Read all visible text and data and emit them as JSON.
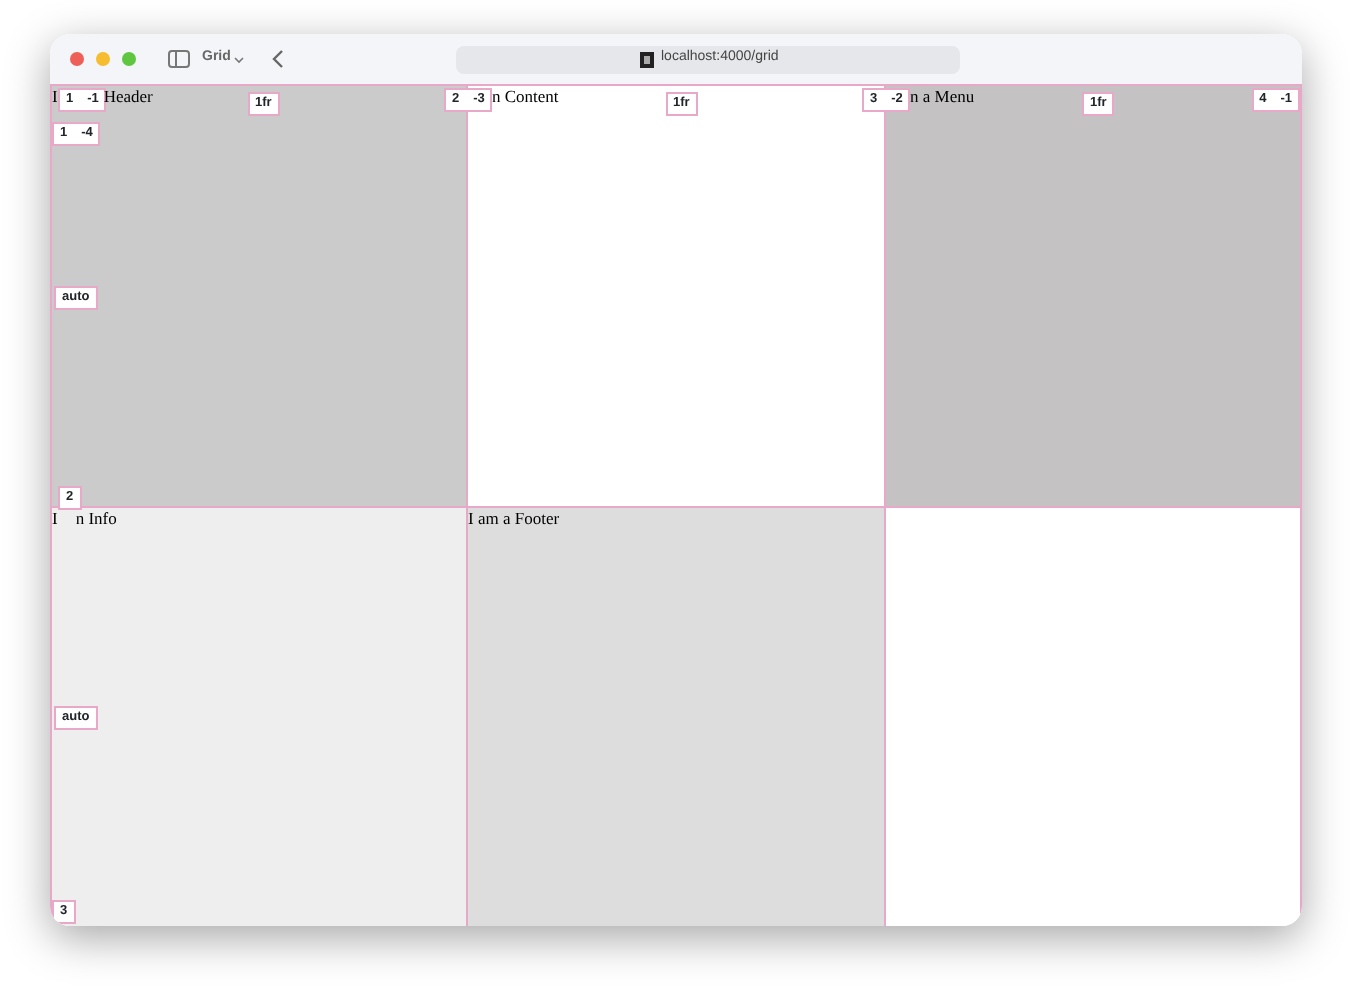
{
  "window": {
    "tab_title": "Grid",
    "url": "localhost:4000/grid"
  },
  "cells": [
    {
      "kind": "split-wide",
      "lead": "I",
      "text": "Header",
      "color": "#cccbcb"
    },
    {
      "kind": "after-badge",
      "text": "n Content",
      "color": "#ffffff"
    },
    {
      "kind": "after-badge",
      "text": "n a Menu",
      "color": "#c4c2c3"
    },
    {
      "kind": "split-narrow",
      "lead": "I",
      "text": "n Info",
      "color": "#eeeeee"
    },
    {
      "kind": "plain",
      "text": "I am a Footer",
      "color": "#dddddd"
    },
    {
      "kind": "empty",
      "color": "#ffffff"
    }
  ],
  "columns": {
    "lines": [
      [
        "1",
        "-1"
      ],
      [
        "2",
        "-3"
      ],
      [
        "3",
        "-2"
      ],
      [
        "4",
        "-1"
      ]
    ],
    "tracks": [
      "1fr",
      "1fr",
      "1fr"
    ]
  },
  "rows": {
    "lines": [
      [
        "1",
        "-4"
      ],
      [
        "2"
      ],
      [
        "3"
      ]
    ],
    "tracks": [
      "auto",
      "auto"
    ]
  }
}
